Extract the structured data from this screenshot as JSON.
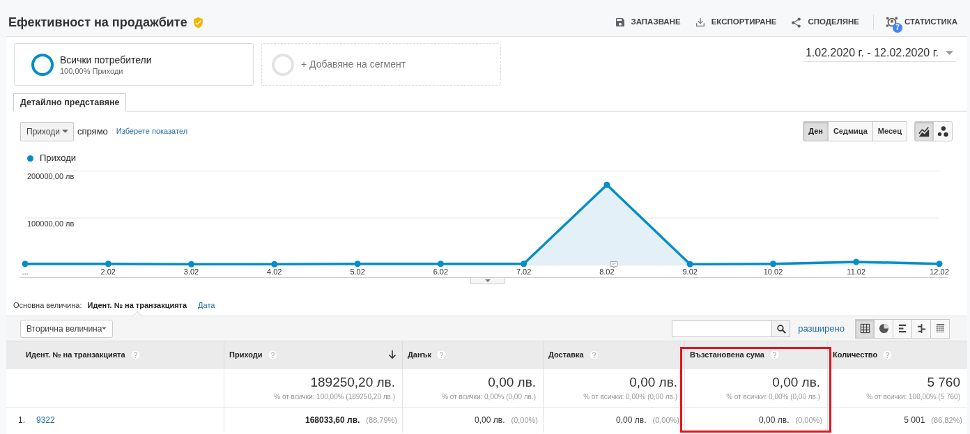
{
  "header": {
    "title": "Ефективност на продажбите",
    "actions": [
      {
        "kind": "save",
        "label": "ЗАПАЗВАНЕ"
      },
      {
        "kind": "export",
        "label": "ЕКСПОРТИРАНЕ"
      },
      {
        "kind": "share",
        "label": "СПОДЕЛЯНЕ"
      },
      {
        "kind": "insights",
        "label": "СТАТИСТИКА",
        "badge": "7"
      }
    ]
  },
  "segments": [
    {
      "kind": "active",
      "name": "Всички потребители",
      "detail": "100,00% Приходи"
    },
    {
      "kind": "add",
      "name": "+ Добавяне на сегмент"
    }
  ],
  "date_range": "1.02.2020 г. - 12.02.2020 г.",
  "tabs": [
    {
      "label": "Детайлно представяне",
      "selected": true
    }
  ],
  "chart_controls": {
    "metric": "Приходи",
    "versus": "спрямо",
    "pick_metric": "Изберете показател",
    "periods": [
      {
        "label": "Ден",
        "selected": true
      },
      {
        "label": "Седмица",
        "selected": false
      },
      {
        "label": "Месец",
        "selected": false
      }
    ],
    "chart_types": [
      {
        "kind": "line",
        "selected": true
      },
      {
        "kind": "motion",
        "selected": false
      }
    ]
  },
  "chart": {
    "chart_data": {
      "type": "area",
      "categories": [
        "...",
        "2.02",
        "3.02",
        "4.02",
        "5.02",
        "6.02",
        "7.02",
        "8.02",
        "9.02",
        "10.02",
        "11.02",
        "12.02"
      ],
      "series": [
        {
          "name": "Приходи",
          "color": "#058dc7",
          "values": [
            2000,
            2000,
            1000,
            1000,
            2000,
            2000,
            2000,
            170000,
            1000,
            2000,
            6000,
            2000
          ]
        }
      ],
      "ylim": [
        0,
        200000
      ],
      "yticks": [
        {
          "value": 100000,
          "label": "100000,00 лв"
        },
        {
          "value": 200000,
          "label": "200000,00 лв"
        }
      ]
    }
  },
  "primary_dimension": {
    "label": "Основна величина:",
    "options": [
      {
        "label": "Идент. № на транзакцията",
        "selected": true
      },
      {
        "label": "Дата",
        "selected": false
      }
    ]
  },
  "table_toolbar": {
    "secondary_dimension": "Вторична величина",
    "advanced": "разширено",
    "views": [
      {
        "kind": "table",
        "selected": true
      },
      {
        "kind": "pie",
        "selected": false
      },
      {
        "kind": "performance",
        "selected": false
      },
      {
        "kind": "comparison",
        "selected": false
      },
      {
        "kind": "pivot",
        "selected": false
      }
    ]
  },
  "table": {
    "columns": [
      {
        "label": "Идент. № на транзакцията",
        "sorted": false,
        "highlighted": false
      },
      {
        "label": "Приходи",
        "sorted": true,
        "highlighted": false
      },
      {
        "label": "Данък",
        "sorted": false,
        "highlighted": false
      },
      {
        "label": "Доставка",
        "sorted": false,
        "highlighted": false
      },
      {
        "label": "Възстановена сума",
        "sorted": false,
        "highlighted": true
      },
      {
        "label": "Количество",
        "sorted": false,
        "highlighted": false
      }
    ],
    "totals": [
      {
        "value": "189250,20 лв.",
        "share": "% от всички: 100,00% (189250,20 лв.)"
      },
      {
        "value": "0,00 лв.",
        "share": "% от всички: 0,00% (0,00 лв.)"
      },
      {
        "value": "0,00 лв.",
        "share": "% от всички: 0,00% (0,00 лв.)"
      },
      {
        "value": "0,00 лв.",
        "share": "% от всички: 0,00% (0,00 лв.)"
      },
      {
        "value": "5 760",
        "share": "% от всички: 100,00% (5 760)"
      }
    ],
    "rows": [
      {
        "number": "1.",
        "id": "9322",
        "cells": [
          {
            "value": "168033,60 лв.",
            "share": "(88,79%)"
          },
          {
            "value": "0,00 лв.",
            "share": "(0,00%)"
          },
          {
            "value": "0,00 лв.",
            "share": "(0,00%)"
          },
          {
            "value": "0,00 лв.",
            "share": "(0,00%)"
          },
          {
            "value": "5 001",
            "share": "(86,82%)"
          }
        ]
      }
    ]
  }
}
